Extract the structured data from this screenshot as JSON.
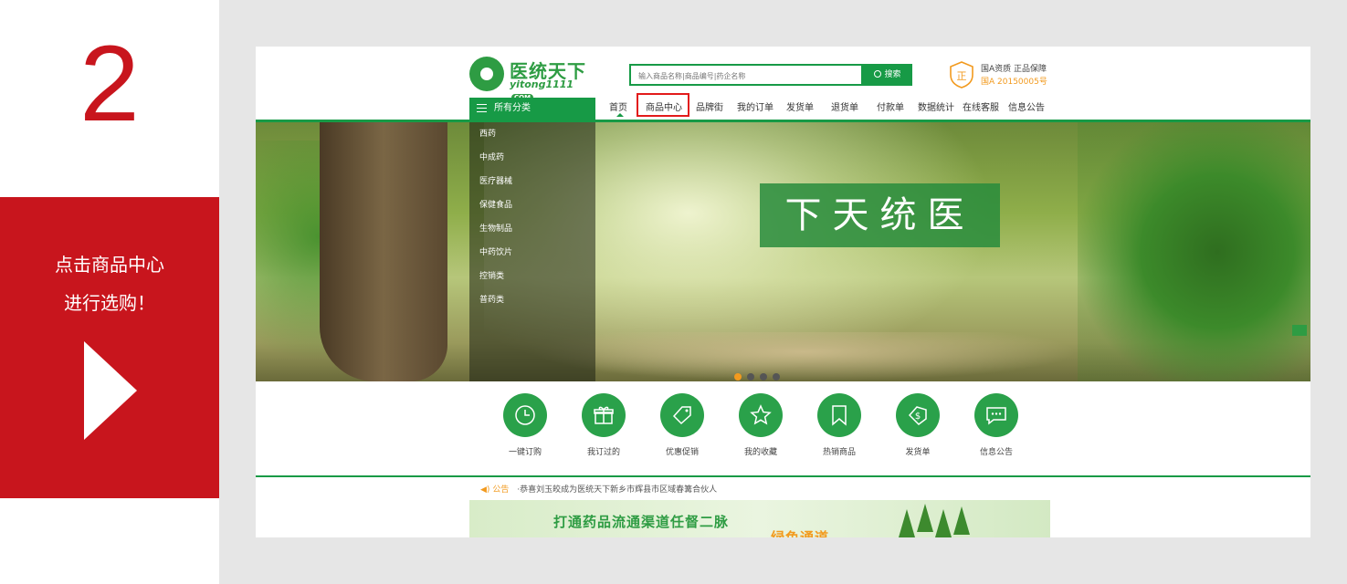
{
  "guide": {
    "step_number": "2",
    "line1": "点击商品中心",
    "line2": "进行选购！"
  },
  "site": {
    "logo": {
      "name": "医统天下",
      "sub": "yitong1111",
      "com": "COM"
    },
    "search": {
      "placeholder": "输入商品名称|商品编号|药企名称",
      "button": "搜索"
    },
    "badge": {
      "glyph": "正",
      "line1": "国A资质 正品保障",
      "line2": "国A 20150005号"
    },
    "nav": {
      "all_categories": "所有分类",
      "items": [
        "首页",
        "商品中心",
        "品牌街",
        "我的订单",
        "发货单",
        "退货单",
        "付款单",
        "数据统计",
        "在线客服",
        "信息公告"
      ],
      "highlighted": "商品中心"
    },
    "categories": [
      "西药",
      "中成药",
      "医疗器械",
      "保健食品",
      "生物制品",
      "中药饮片",
      "控销类",
      "普药类"
    ],
    "banner": {
      "sign_text": "下天统医",
      "slide_count": 4,
      "active_slide": 1
    },
    "quick_links": [
      {
        "label": "一键订购",
        "icon": "clock-icon"
      },
      {
        "label": "我订过的",
        "icon": "gift-icon"
      },
      {
        "label": "优惠促销",
        "icon": "tag-icon"
      },
      {
        "label": "我的收藏",
        "icon": "star-icon"
      },
      {
        "label": "热销商品",
        "icon": "bookmark-icon"
      },
      {
        "label": "发货单",
        "icon": "dollar-tag-icon"
      },
      {
        "label": "信息公告",
        "icon": "message-icon"
      }
    ],
    "notice": {
      "label": "公告",
      "text": "·恭喜刘玉皎成为医统天下新乡市辉县市区域春篝合伙人"
    },
    "ad": {
      "line1": "打通药品流通渠道任督二脉",
      "line2": "绿色通道"
    },
    "colors": {
      "brand_green": "#179a46",
      "accent_orange": "#f29a1e",
      "highlight_red": "#e21b1b",
      "guide_red": "#c8151d"
    }
  }
}
